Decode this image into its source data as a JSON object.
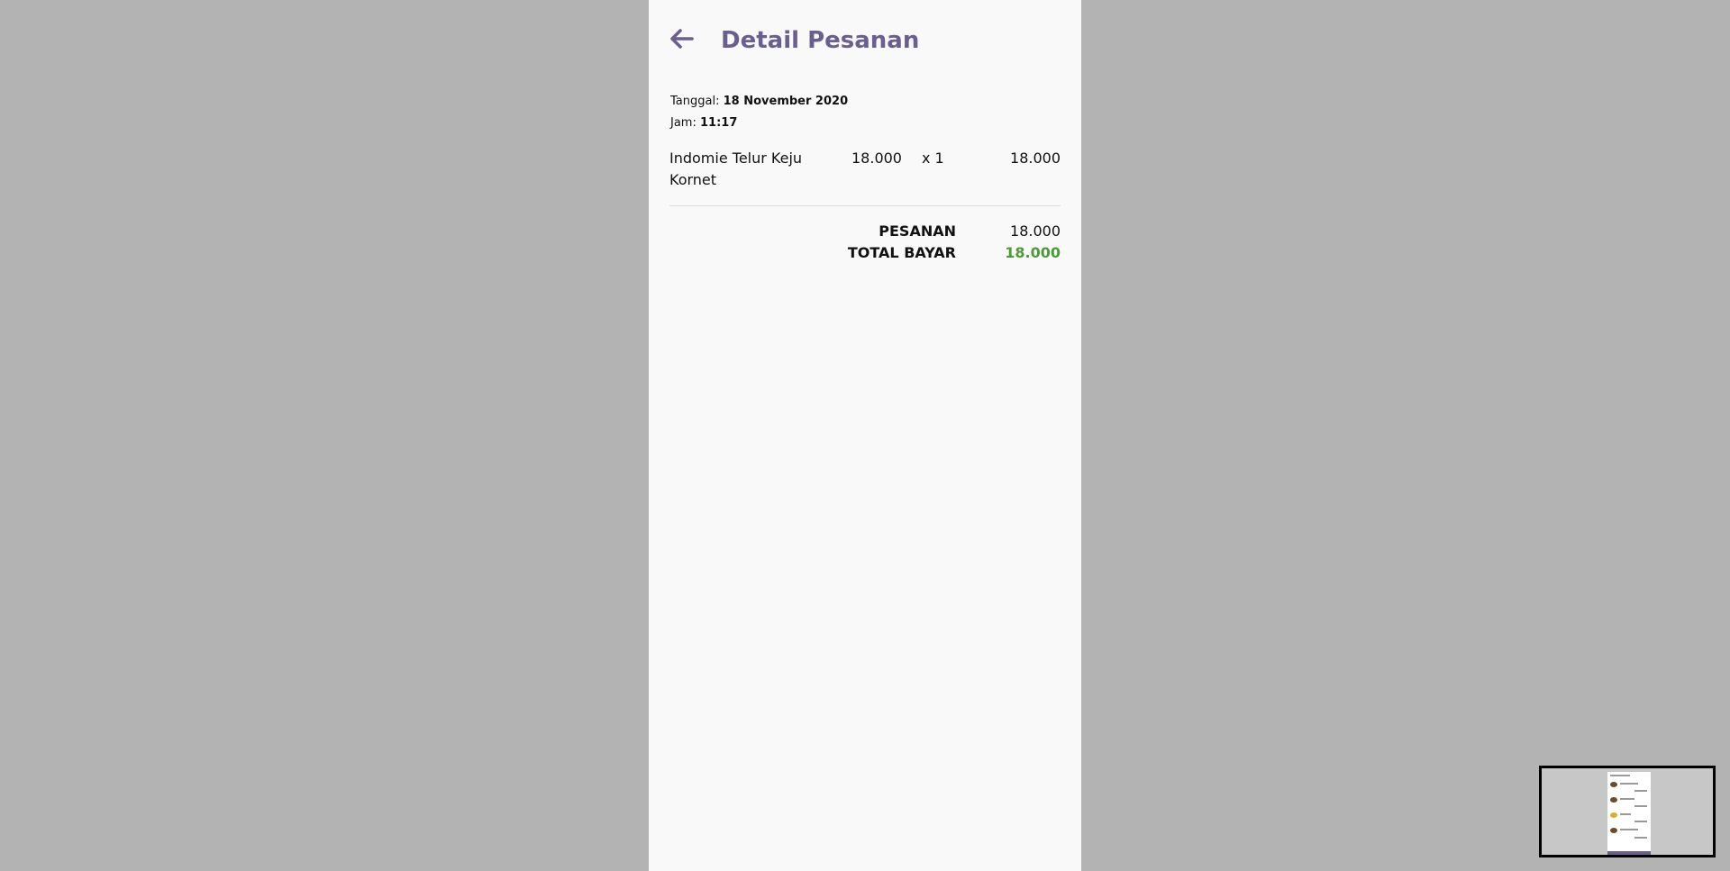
{
  "header": {
    "title": "Detail Pesanan",
    "back_icon": "arrow-left-icon",
    "accent_color": "#6a5f8e"
  },
  "order": {
    "date_label": "Tanggal:",
    "date_value": "18 November 2020",
    "time_label": "Jam:",
    "time_value": "11:17",
    "items": [
      {
        "name": "Indomie Telur Keju Kornet",
        "price": "18.000",
        "qty": "x 1",
        "subtotal": "18.000"
      }
    ]
  },
  "summary": {
    "order_label": "PESANAN",
    "order_value": "18.000",
    "total_label": "TOTAL BAYAR",
    "total_value": "18.000",
    "total_color": "#4e9a3a"
  }
}
